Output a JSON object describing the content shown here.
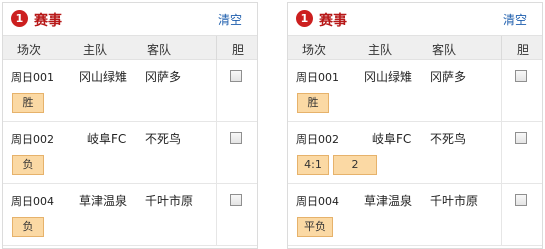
{
  "panels": [
    {
      "badge": "1",
      "title": "赛事",
      "clear": "清空",
      "headers": {
        "no": "场次",
        "home": "主队",
        "away": "客队",
        "bold": "胆"
      },
      "rows": [
        {
          "no": "周日001",
          "home": "冈山绿雉",
          "away": "冈萨多",
          "picks": [
            "胜"
          ]
        },
        {
          "no": "周日002",
          "home": "岐阜FC",
          "away": "不死鸟",
          "picks": [
            "负"
          ]
        },
        {
          "no": "周日004",
          "home": "草津温泉",
          "away": "千叶市原",
          "picks": [
            "负"
          ]
        }
      ]
    },
    {
      "badge": "1",
      "title": "赛事",
      "clear": "清空",
      "headers": {
        "no": "场次",
        "home": "主队",
        "away": "客队",
        "bold": "胆"
      },
      "rows": [
        {
          "no": "周日001",
          "home": "冈山绿雉",
          "away": "冈萨多",
          "picks": [
            "胜"
          ]
        },
        {
          "no": "周日002",
          "home": "岐阜FC",
          "away": "不死鸟",
          "picks": [
            "4:1",
            "2"
          ]
        },
        {
          "no": "周日004",
          "home": "草津温泉",
          "away": "千叶市原",
          "picks": [
            "平负"
          ]
        }
      ]
    }
  ],
  "colors": {
    "badge": "#cc1f1f",
    "title": "#b71818",
    "clear": "#1f5fae",
    "chip": "#fbd9a4",
    "header_bg": "#efefef"
  }
}
